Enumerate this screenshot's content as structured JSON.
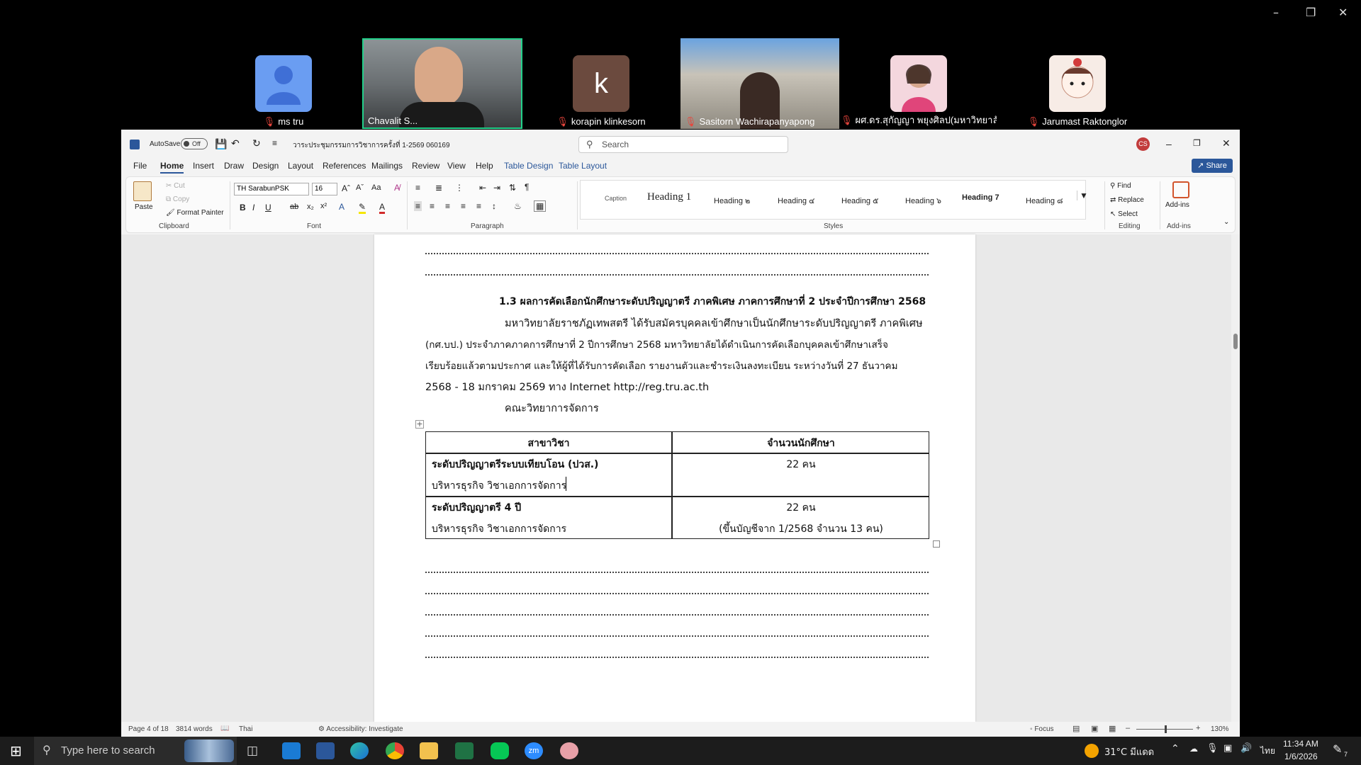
{
  "participants": [
    {
      "name": "ms tru"
    },
    {
      "name": "Chavalit S..."
    },
    {
      "name": "korapin klinkesorn",
      "initial": "k"
    },
    {
      "name": "Sasitorn Wachirapanyapong"
    },
    {
      "name": "ผศ.ดร.สุกัญญา พยุงศิลป(มหาวิทยาลัยร..."
    },
    {
      "name": "Jarumast Raktonglor"
    }
  ],
  "word": {
    "autosave_label": "AutoSave",
    "autosave_state": "Off",
    "doc_title": "วาระประชุมกรรมการวิชาการครั้งที่ 1-2569 060169",
    "search_placeholder": "Search",
    "user_initials": "CS",
    "share_label": "Share",
    "tabs": [
      "File",
      "Home",
      "Insert",
      "Draw",
      "Design",
      "Layout",
      "References",
      "Mailings",
      "Review",
      "View",
      "Help",
      "Table Design",
      "Table Layout"
    ],
    "clipboard": {
      "paste": "Paste",
      "cut": "Cut",
      "copy": "Copy",
      "format_painter": "Format Painter",
      "label": "Clipboard"
    },
    "font": {
      "name": "TH SarabunPSK",
      "size": "16",
      "label": "Font"
    },
    "paragraph_label": "Paragraph",
    "styles": [
      "Caption",
      "Heading 1",
      "Heading ๒",
      "Heading ๔",
      "Heading ๕",
      "Heading ๖",
      "Heading 7",
      "Heading ๘"
    ],
    "styles_label": "Styles",
    "editing": {
      "find": "Find",
      "replace": "Replace",
      "select": "Select",
      "label": "Editing"
    },
    "addins": {
      "button": "Add-ins",
      "label": "Add-ins"
    }
  },
  "document": {
    "heading": "1.3 ผลการคัดเลือกนักศึกษาระดับปริญญาตรี ภาคพิเศษ ภาคการศึกษาที่ 2 ประจำปีการศึกษา 2568",
    "para_lines": [
      "มหาวิทยาลัยราชภัฏเทพสตรี ได้รับสมัครบุคคลเข้าศึกษาเป็นนักศึกษาระดับปริญญาตรี ภาคพิเศษ",
      "(กศ.บป.) ประจำภาคภาคการศึกษาที่ 2 ปีการศึกษา 2568 มหาวิทยาลัยได้ดำเนินการคัดเลือกบุคคลเข้าศึกษาเสร็จ",
      "เรียบร้อยแล้วตามประกาศ และให้ผู้ที่ได้รับการคัดเลือก รายงานตัวและชำระเงินลงทะเบียน ระหว่างวันที่ 27 ธันวาคม",
      "2568 - 18 มกราคม 2569 ทาง Internet http://reg.tru.ac.th"
    ],
    "faculty": "คณะวิทยาการจัดการ",
    "table": {
      "headers": [
        "สาขาวิชา",
        "จำนวนนักศึกษา"
      ],
      "rows": [
        {
          "level": "ระดับปริญญาตรีระบบเทียบโอน (ปวส.)",
          "program": "บริหารธุรกิจ วิชาเอกการจัดการ",
          "count": "22 คน",
          "note": ""
        },
        {
          "level": "ระดับปริญญาตรี 4 ปี",
          "program": "บริหารธุรกิจ วิชาเอกการจัดการ",
          "count": "22 คน",
          "note": "(ขึ้นบัญชีจาก 1/2568 จำนวน 13 คน)"
        }
      ]
    }
  },
  "status": {
    "page": "Page 4 of 18",
    "words": "3814 words",
    "language": "Thai",
    "accessibility": "Accessibility: Investigate",
    "focus": "Focus",
    "zoom": "130%"
  },
  "taskbar": {
    "search_placeholder": "Type here to search",
    "weather": "31°C มีแดด",
    "lang": "ไทย",
    "time": "11:34 AM",
    "date": "1/6/2026",
    "notif_count": "7"
  }
}
